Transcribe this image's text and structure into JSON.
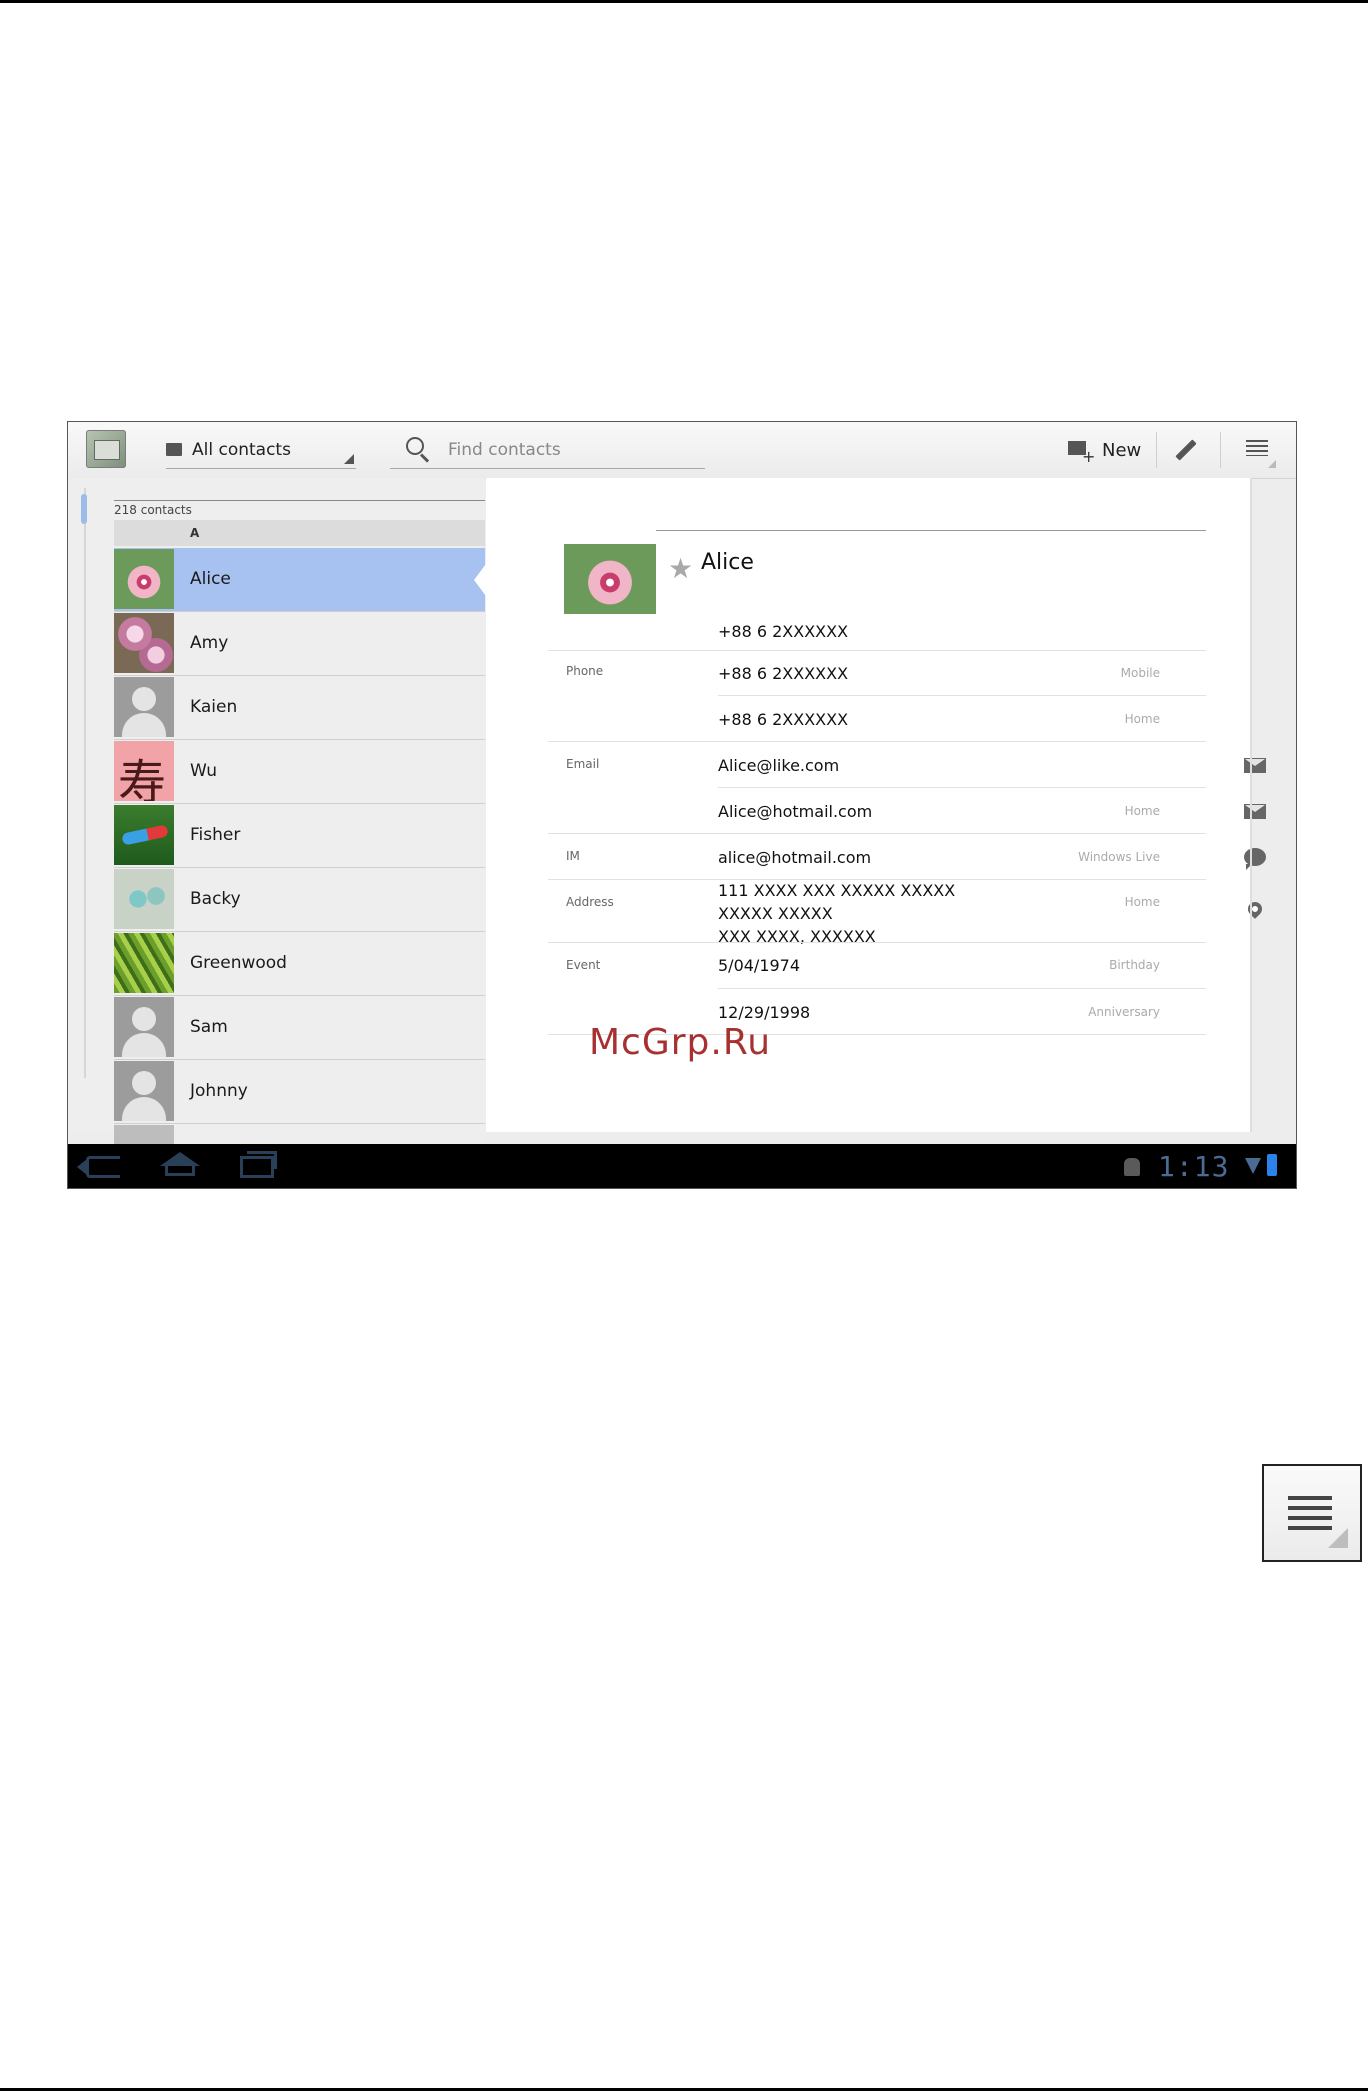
{
  "watermark": "McGrp.Ru",
  "toolbar": {
    "filter_label": "All contacts",
    "search_placeholder": "Find contacts",
    "new_label": "New",
    "icons": [
      "app-contacts-icon",
      "folder-icon",
      "search-icon",
      "add-contact-icon",
      "pencil-icon",
      "menu-icon"
    ]
  },
  "list": {
    "count": "218 contacts",
    "section_letter": "A",
    "contacts": [
      {
        "name": "Alice",
        "selected": true
      },
      {
        "name": "Amy"
      },
      {
        "name": "Kaien"
      },
      {
        "name": "Wu"
      },
      {
        "name": "Fisher"
      },
      {
        "name": "Backy"
      },
      {
        "name": "Greenwood"
      },
      {
        "name": "Sam"
      },
      {
        "name": "Johnny"
      }
    ]
  },
  "detail": {
    "name": "Alice",
    "first_number": "+88 6 2XXXXXX",
    "phone": {
      "label": "Phone",
      "entries": [
        {
          "value": "+88 6 2XXXXXX",
          "type": "Mobile"
        },
        {
          "value": "+88 6 2XXXXXX",
          "type": "Home"
        }
      ]
    },
    "email": {
      "label": "Email",
      "entries": [
        {
          "value": "Alice@like.com",
          "type": ""
        },
        {
          "value": "Alice@hotmail.com",
          "type": "Home"
        }
      ]
    },
    "im": {
      "label": "IM",
      "value": "alice@hotmail.com",
      "type": "Windows Live"
    },
    "address": {
      "label": "Address",
      "lines": [
        "111 XXXX XXX XXXXX XXXXX",
        "XXXXX XXXXX",
        "XXX XXXX, XXXXXX"
      ],
      "type": "Home"
    },
    "event": {
      "label": "Event",
      "entries": [
        {
          "value": "5/04/1974",
          "type": "Birthday"
        },
        {
          "value": "12/29/1998",
          "type": "Anniversary"
        }
      ]
    }
  },
  "status_bar": {
    "clock": "1:13",
    "colors": {
      "accent": "#4a6b94",
      "battery": "#2b82e8",
      "selection": "#a7c2f0"
    }
  }
}
